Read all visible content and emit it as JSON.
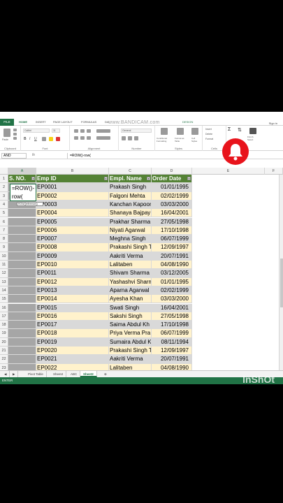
{
  "menubar": {
    "file": "FILE",
    "tabs": [
      "HOME",
      "INSERT",
      "PAGE LAYOUT",
      "FORMULAS",
      "DA",
      "DESIGN"
    ],
    "watermark": "www.BANDICAM.com",
    "signin": "Sign in"
  },
  "ribbon": {
    "groups": [
      "Clipboard",
      "Font",
      "Alignment",
      "Number",
      "Styles",
      "Cells"
    ],
    "font_name": "Calibri",
    "font_size": "11",
    "number_format": "General",
    "paste": "Paste",
    "styles": [
      "Conditional Formatting",
      "Format as Table",
      "Cell Styles"
    ],
    "cells": [
      "Insert",
      "Delete",
      "Format"
    ],
    "find": "Find & Select"
  },
  "formulabar": {
    "namebox": "AND",
    "fx": "fx",
    "formula": "=ROW()-row("
  },
  "columns": [
    "A",
    "B",
    "C",
    "D",
    "E",
    "F"
  ],
  "headers": [
    "S. NO.",
    "Emp ID",
    "Empl. Name",
    "Order Date"
  ],
  "editor": {
    "line1": "=ROW()-",
    "line2": "row(",
    "tooltip": "ROW([reference])"
  },
  "rows": [
    {
      "n": "1"
    },
    {
      "n": "2",
      "emp": "EP0001",
      "name": "Prakash Singh",
      "date": "01/01/1995"
    },
    {
      "n": "3",
      "emp": "EP0002",
      "name": "Falgoni Mehta",
      "date": "02/02/1999"
    },
    {
      "n": "4",
      "emp": "EP0003",
      "name": "Kanchan Kapoor",
      "date": "03/03/2000"
    },
    {
      "n": "5",
      "emp": "EP0004",
      "name": "Shanaya Bajpay",
      "date": "16/04/2001"
    },
    {
      "n": "6",
      "emp": "EP0005",
      "name": "Prakhar Sharma",
      "date": "27/05/1998"
    },
    {
      "n": "7",
      "emp": "EP0006",
      "name": "Niyati Agarwal",
      "date": "17/10/1998"
    },
    {
      "n": "8",
      "emp": "EP0007",
      "name": "Meghna Singh",
      "date": "06/07/1999"
    },
    {
      "n": "9",
      "emp": "EP0008",
      "name": "Prakashi Singh T",
      "date": "12/09/1997"
    },
    {
      "n": "10",
      "emp": "EP0009",
      "name": "Aakriti Verma",
      "date": "20/07/1991"
    },
    {
      "n": "11",
      "emp": "EP0010",
      "name": "Lalitaben",
      "date": "04/08/1990"
    },
    {
      "n": "12",
      "emp": "EP0011",
      "name": "Shivam Sharma",
      "date": "03/12/2005"
    },
    {
      "n": "13",
      "emp": "EP0012",
      "name": "Yashashvi Sharma",
      "date": "01/01/1995"
    },
    {
      "n": "14",
      "emp": "EP0013",
      "name": "Aparna Agarwal",
      "date": "02/02/1999"
    },
    {
      "n": "15",
      "emp": "EP0014",
      "name": "Ayesha Khan",
      "date": "03/03/2000"
    },
    {
      "n": "16",
      "emp": "EP0015",
      "name": "Swati Singh",
      "date": "16/04/2001"
    },
    {
      "n": "17",
      "emp": "EP0016",
      "name": "Sakshi Singh",
      "date": "27/05/1998"
    },
    {
      "n": "18",
      "emp": "EP0017",
      "name": "Saima Abdul Kh",
      "date": "17/10/1998"
    },
    {
      "n": "19",
      "emp": "EP0018",
      "name": "Priya Verma Pra",
      "date": "06/07/1999"
    },
    {
      "n": "20",
      "emp": "EP0019",
      "name": "Sumaira Abdul K",
      "date": "08/11/1994"
    },
    {
      "n": "21",
      "emp": "EP0020",
      "name": "Prakashi Singh T",
      "date": "12/09/1997"
    },
    {
      "n": "22",
      "emp": "EP0021",
      "name": "Aakriti Verma",
      "date": "20/07/1991"
    },
    {
      "n": "23",
      "emp": "EP0022",
      "name": "Lalitaben",
      "date": "04/08/1990"
    }
  ],
  "sheets": [
    "Pivot Table",
    "Sheet4",
    "ABC",
    "Sheet2"
  ],
  "status": "ENTER",
  "corner_watermark": "InShOt",
  "colors": {
    "excel_green": "#217346",
    "header_green": "#548235",
    "band_yellow": "#fff2cc",
    "band_gray": "#d9d9d9",
    "bell_red": "#e8131b"
  }
}
